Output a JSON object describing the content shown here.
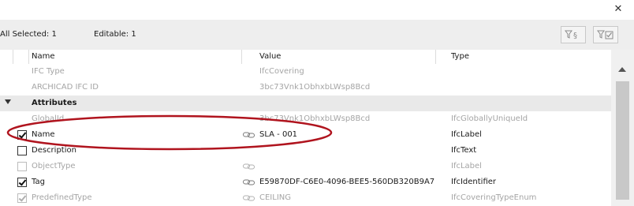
{
  "window": {
    "close_glyph": "✕"
  },
  "toolbar": {
    "all_selected": "All Selected: 1",
    "editable": "Editable: 1",
    "filter_button_1": "filter-section-icon",
    "filter_button_2": "filter-checked-icon"
  },
  "columns": {
    "name": "Name",
    "value": "Value",
    "type": "Type"
  },
  "rows": [
    {
      "name": "IFC Type",
      "value": "IfcCovering",
      "type": ""
    },
    {
      "name": "ARCHICAD IFC ID",
      "value": "3bc73Vnk1ObhxbLWsp8Bcd",
      "type": ""
    },
    {
      "section": "Attributes"
    },
    {
      "name": "GlobalId",
      "value": "3bc73Vnk1ObhxbLWsp8Bcd",
      "type": "IfcGloballyUniqueId"
    },
    {
      "name": "Name",
      "value": "SLA - 001",
      "type": "IfcLabel",
      "checked": true
    },
    {
      "name": "Description",
      "value": "",
      "type": "IfcText",
      "checked": false
    },
    {
      "name": "ObjectType",
      "value": "",
      "type": "IfcLabel",
      "checked": false
    },
    {
      "name": "Tag",
      "value": "E59870DF-C6E0-4096-BEE5-560DB320B9A7",
      "type": "IfcIdentifier",
      "checked": true
    },
    {
      "name": "PredefinedType",
      "value": "CEILING",
      "type": "IfcCoveringTypeEnum",
      "checked": true
    }
  ],
  "colors": {
    "annotation": "#b0141e",
    "section_bg": "#e9e9e9",
    "dim_text": "#a5a5a5"
  }
}
